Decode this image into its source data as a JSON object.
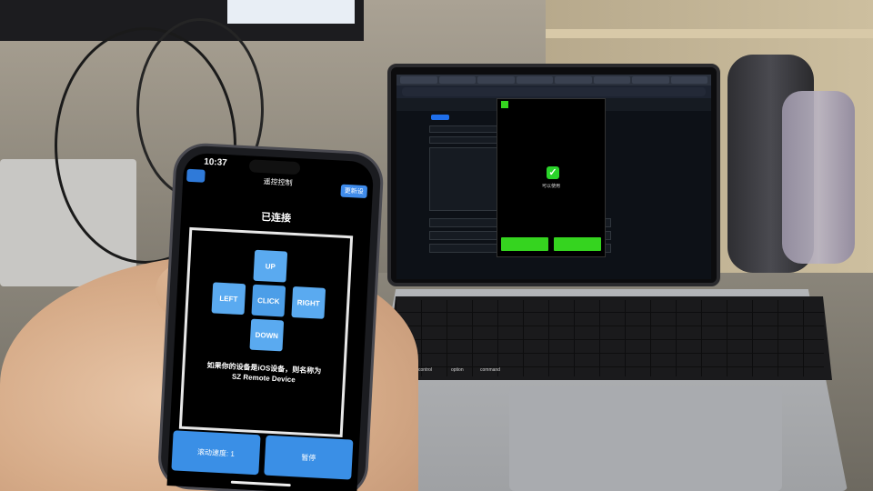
{
  "laptop": {
    "overlay_status": "可以使用"
  },
  "keyboard": {
    "key_control": "control",
    "key_option": "option",
    "key_command": "command"
  },
  "phone": {
    "status_time": "10:37",
    "header_title": "遥控控制",
    "header_right_button": "更新设",
    "connection_status": "已连接",
    "dpad": {
      "up": "UP",
      "left": "LEFT",
      "click": "CLICK",
      "right": "RIGHT",
      "down": "DOWN"
    },
    "hint_line1": "如果你的设备是iOS设备，则名称为",
    "hint_line2": "SZ Remote Device",
    "bottom_left_button": "滚动速度: 1",
    "bottom_right_button": "暂停"
  },
  "colors": {
    "dpad_button": "#5aaaf0",
    "success_green": "#35d41f",
    "phone_header_blue": "#3f8bea"
  }
}
